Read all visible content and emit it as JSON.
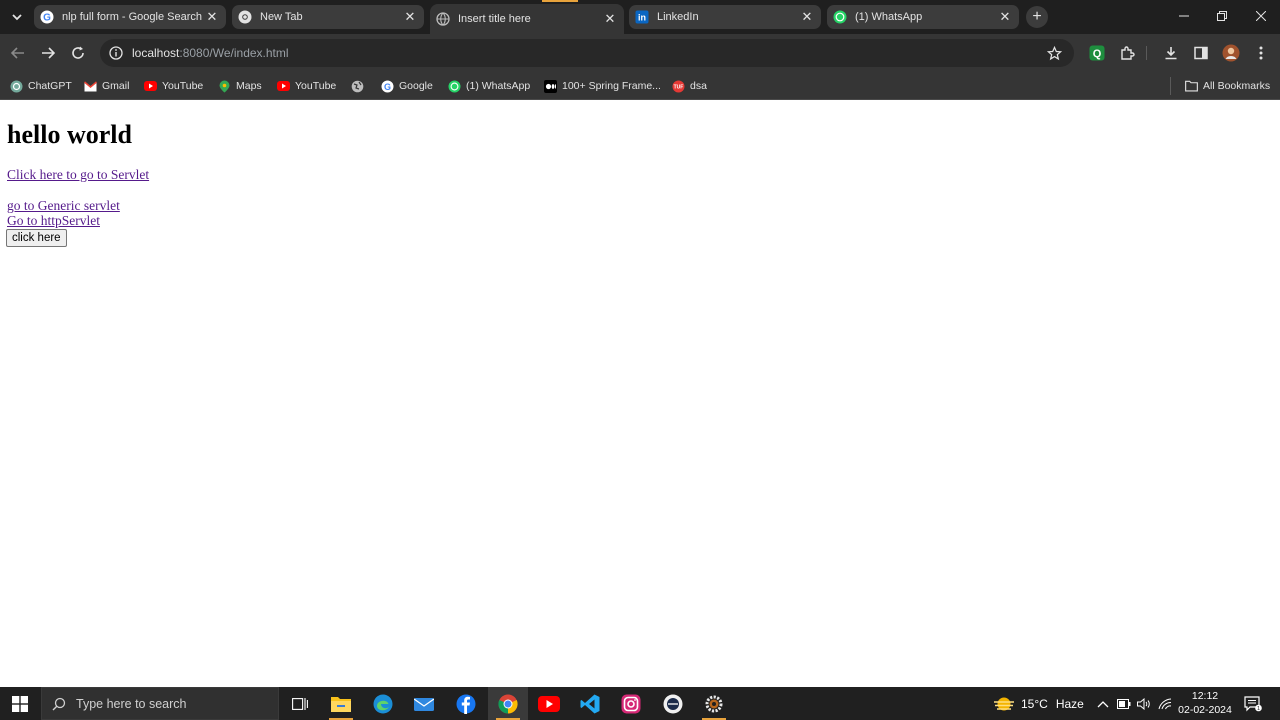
{
  "browser": {
    "tabs": [
      {
        "title": "nlp full form - Google Search",
        "favicon": "google-icon"
      },
      {
        "title": "New Tab",
        "favicon": "chrome-icon"
      },
      {
        "title": "Insert title here",
        "favicon": "globe-icon"
      },
      {
        "title": "LinkedIn",
        "favicon": "linkedin-icon"
      },
      {
        "title": "(1) WhatsApp",
        "favicon": "whatsapp-icon"
      }
    ],
    "active_tab_index": 2,
    "address": {
      "host": "localhost",
      "path": ":8080/We/index.html"
    },
    "bookmarks": [
      {
        "label": "ChatGPT",
        "icon": "chatgpt-icon"
      },
      {
        "label": "Gmail",
        "icon": "gmail-icon"
      },
      {
        "label": "YouTube",
        "icon": "youtube-icon"
      },
      {
        "label": "Maps",
        "icon": "maps-icon"
      },
      {
        "label": "YouTube",
        "icon": "youtube-icon"
      },
      {
        "label": "",
        "icon": "globe-icon"
      },
      {
        "label": "Google",
        "icon": "google-icon"
      },
      {
        "label": "(1) WhatsApp",
        "icon": "whatsapp-icon"
      },
      {
        "label": "100+ Spring Frame...",
        "icon": "medium-icon"
      },
      {
        "label": "dsa",
        "icon": "gfg-icon"
      }
    ],
    "all_bookmarks_label": "All Bookmarks",
    "profile_extension_badge": "Q"
  },
  "page": {
    "heading": "hello world",
    "link_servlet": "Click here to go to Servlet",
    "link_generic": "go to Generic servlet",
    "link_http": "Go to httpServlet",
    "button_label": "click here"
  },
  "taskbar": {
    "search_placeholder": "Type here to search",
    "weather": {
      "temp": "15°C",
      "condition": "Haze"
    },
    "time": "12:12",
    "date": "02-02-2024"
  },
  "colors": {
    "chrome_dark": "#1f1f1f",
    "toolbar": "#353535",
    "visited_link": "#551a8b",
    "accent": "#e8a33c"
  }
}
